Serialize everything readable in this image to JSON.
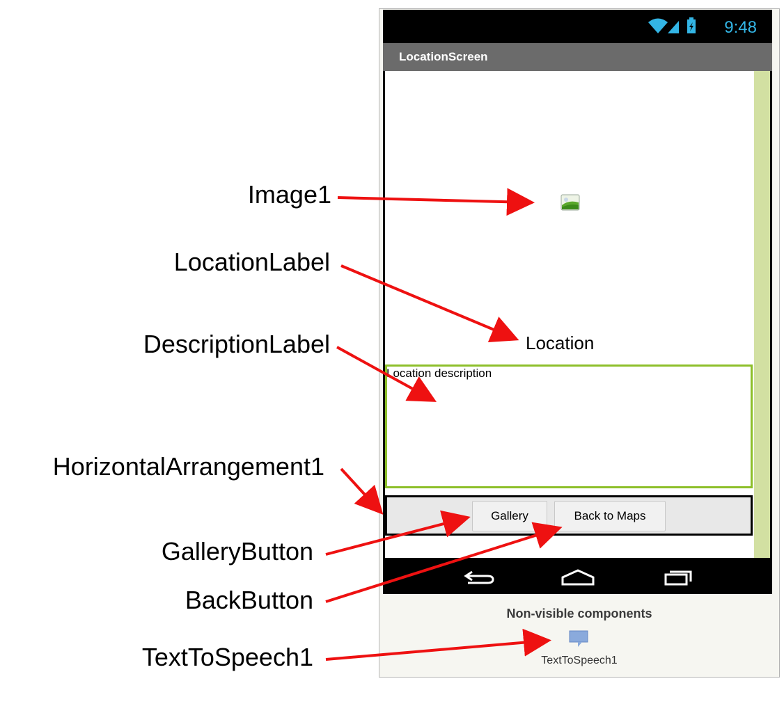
{
  "status_bar": {
    "time": "9:48",
    "icons": [
      "wifi-icon",
      "signal-icon",
      "battery-icon"
    ]
  },
  "screen": {
    "title": "LocationScreen"
  },
  "components": {
    "image1": {
      "icon": "image-placeholder-icon"
    },
    "location_label": {
      "text": "Location"
    },
    "description_label": {
      "text": "Location description"
    },
    "gallery_button": {
      "label": "Gallery"
    },
    "back_button": {
      "label": "Back to Maps"
    }
  },
  "nav_bar": {
    "icons": [
      "back-nav-icon",
      "home-nav-icon",
      "recents-nav-icon"
    ]
  },
  "non_visible": {
    "title": "Non-visible components",
    "items": [
      {
        "label": "TextToSpeech1",
        "icon": "speech-bubble-icon"
      }
    ]
  },
  "annotations": {
    "image1": "Image1",
    "location_label": "LocationLabel",
    "description_label": "DescriptionLabel",
    "horizontal_arrangement": "HorizontalArrangement1",
    "gallery_button": "GalleryButton",
    "back_button": "BackButton",
    "text_to_speech": "TextToSpeech1"
  },
  "colors": {
    "arrow": "#ee1111",
    "status_text": "#33b5e5",
    "title_bar": "#6b6b6b",
    "scroll_strip": "#d2e0a2",
    "description_border": "#8dbf2a"
  }
}
